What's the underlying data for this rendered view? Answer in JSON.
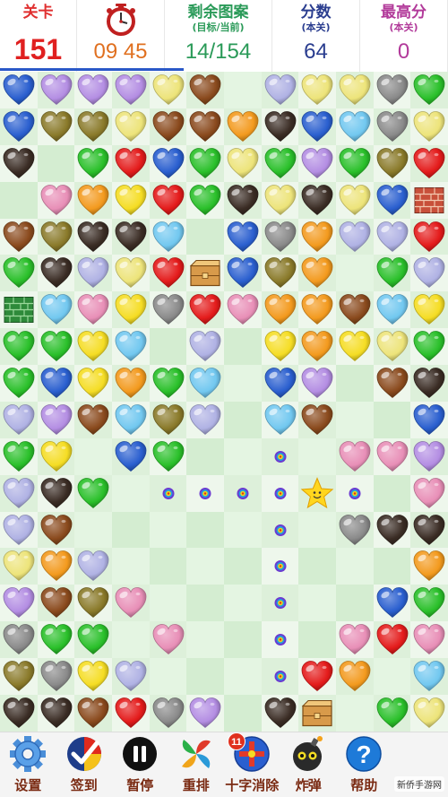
{
  "hud": {
    "level_label": "关卡",
    "level_value": "151",
    "timer_value": "09 45",
    "remaining_label": "剩余图案",
    "remaining_sub": "(目标/当前)",
    "remaining_value": "14/154",
    "score_label": "分数",
    "score_sub": "(本关)",
    "score_value": "64",
    "best_label": "最高分",
    "best_sub": "(本关)",
    "best_value": "0"
  },
  "colors": {
    "R": "#e41b1b",
    "G": "#2ac02a",
    "B": "#2a5fcf",
    "C": "#72c8f0",
    "Y": "#f5dd24",
    "O": "#f39a1e",
    "P": "#b48ee3",
    "K": "#e88fb7",
    "L": "#b0b2e4",
    "M": "#ede47a",
    "E": "#8a8a8a",
    "N": "#8a4a1d",
    "D": "#3a2c24",
    "V": "#8a7a2a"
  },
  "board": {
    "legend": {
      ".": "empty",
      "R": "red-heart",
      "G": "green-heart",
      "B": "blue-heart",
      "C": "light-blue-heart",
      "Y": "yellow-heart",
      "O": "orange-heart",
      "P": "purple-heart",
      "K": "pink-heart",
      "L": "lavender-heart",
      "M": "pale-yellow-heart",
      "E": "gray-heart",
      "N": "brown-heart",
      "D": "dark-heart",
      "V": "olive-heart",
      "W": "red-brick-block",
      "H": "green-brick-block",
      "X": "wooden-crate",
      "S": "star-cursor",
      "o": "path-dot",
      "F": "brown-tile"
    },
    "rows": [
      "BPPPMN.LMMEG",
      "BVVMNNODBCEM",
      "D.GRBGMGPGVR",
      ".KOYRGDMDMBW",
      "NVDDC.BEOLLR",
      "GDLMRXBVO.GL",
      "HCKYERKOONCY",
      "GGYC.L.YOYMG",
      "GBYOGC.BP.ND",
      "LPNCVL.CN..B",
      "GY.BG..o.KKP",
      "LDG.ooooSo.K",
      "LN.....o.EDD",
      "MOL....o...O",
      "PNVK...o..BG",
      "EGG.K..o.KRK",
      "VEYL...oRO.C",
      "DDNREP.DX.GM"
    ]
  },
  "toolbar": [
    {
      "label": "设置",
      "icon": "gear-icon"
    },
    {
      "label": "签到",
      "icon": "check-in-icon"
    },
    {
      "label": "暂停",
      "icon": "pause-icon"
    },
    {
      "label": "重排",
      "icon": "shuffle-icon"
    },
    {
      "label": "十字消除",
      "icon": "cross-clear-icon",
      "badge": "11"
    },
    {
      "label": "炸弹",
      "icon": "bomb-icon"
    },
    {
      "label": "帮助",
      "icon": "help-icon"
    }
  ],
  "watermark": "新侨手游网"
}
